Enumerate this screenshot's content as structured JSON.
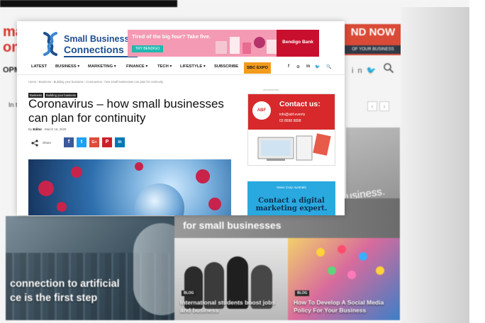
{
  "background_site": {
    "logo_fragment": "ma\non",
    "nav_fragment": "OPM",
    "ad_big_text": "ND NOW",
    "ad_small_text": "OF YOUR BUSINESS",
    "in_text": "In t",
    "hero_right_text": "usiness.",
    "tiles": {
      "ai_caption_line1": "connection to artificial",
      "ai_caption_line2": "ce is the first step",
      "small_biz_caption": "for small businesses",
      "international_badge": "BLOG",
      "international_caption": "International students boost jobs and business",
      "social_badge": "BLOG",
      "social_caption": "How To Develop A Social Media Policy For Your Business"
    }
  },
  "article_page": {
    "logo": {
      "line1": "Small Business",
      "line2": "Connections"
    },
    "banner": {
      "headline": "Tired of the big four? Take five.",
      "button": "TRY BENDIGO",
      "brand": "Bendigo Bank"
    },
    "nav": {
      "items": [
        "LATEST",
        "BUSINESS ▾",
        "MARKETING ▾",
        "FINANCE ▾",
        "TECH ▾",
        "LIFESTYLE ▾",
        "SUBSCRIBE"
      ],
      "highlight": "SBC EXPO",
      "social": [
        "f",
        "⊙",
        "in",
        "🐦",
        "🔍"
      ]
    },
    "breadcrumb": "Home › Business › Building your business › Coronavirus - how small businesses can plan for continuity",
    "tags": [
      "Business",
      "Building your business"
    ],
    "title": "Coronavirus – how small businesses can plan for continuity",
    "byline_prefix": "By",
    "author": "Editor",
    "date": "March 16, 2020",
    "share_label": "Share",
    "share_buttons": [
      "f",
      "t",
      "G+",
      "P",
      "in"
    ],
    "sidebar": {
      "ad_label": "- Advertisement -",
      "contact_ad": {
        "logo": "ABF",
        "heading": "Contact us:",
        "email": "info@abf.events",
        "phone": "03 8698 9898"
      },
      "newscorp_ad": {
        "brand": "News Corp Australia",
        "headline": "Contact a digital marketing expert."
      }
    }
  },
  "colors": {
    "brand_blue": "#1d4f91",
    "expo_orange": "#f29b1d",
    "bendigo_red": "#c8102e",
    "contact_red": "#d7292b",
    "newscorp_blue": "#29a9df"
  }
}
